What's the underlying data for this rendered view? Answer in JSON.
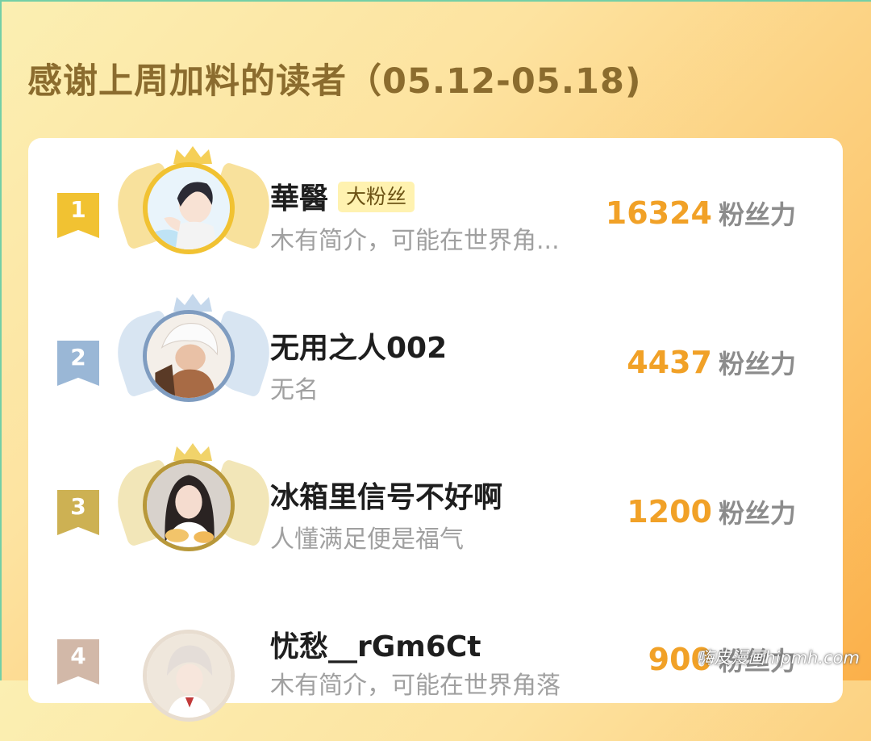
{
  "header": {
    "title": "感谢上周加料的读者（05.12-05.18)"
  },
  "colors": {
    "gold": "#f1c232",
    "silver": "#8eb0d3",
    "bronze": "#c8ab4a",
    "fourth": "#d2b8a8",
    "score": "#f1a127"
  },
  "readers": [
    {
      "rank": "1",
      "name": "華醫",
      "tag": "大粉丝",
      "desc": "木有简介，可能在世界角...",
      "score": "16324",
      "unit": "粉丝力",
      "avatar": "anime-boy-avatar"
    },
    {
      "rank": "2",
      "name": "无用之人002",
      "tag": "",
      "desc": "无名",
      "score": "4437",
      "unit": "粉丝力",
      "avatar": "white-hair-character-avatar"
    },
    {
      "rank": "3",
      "name": "冰箱里信号不好啊",
      "tag": "",
      "desc": "人懂满足便是福气",
      "score": "1200",
      "unit": "粉丝力",
      "avatar": "girl-photo-avatar"
    },
    {
      "rank": "4",
      "name": "忧愁__rGm6Ct",
      "tag": "",
      "desc": "木有简介，可能在世界角落",
      "score": "900",
      "unit": "粉丝力",
      "avatar": "silver-hair-anime-avatar"
    }
  ],
  "watermark": "嗨皮漫画hipmh.com"
}
